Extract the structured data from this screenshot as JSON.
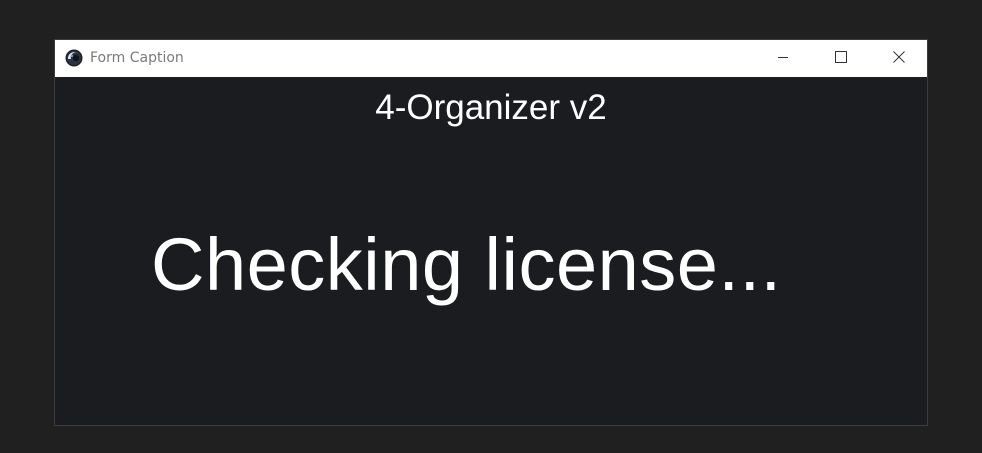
{
  "window": {
    "title": "Form Caption",
    "controls": {
      "minimize_icon": "minimize-icon",
      "maximize_icon": "maximize-icon",
      "close_icon": "close-icon"
    }
  },
  "content": {
    "app_name": "4-Organizer v2",
    "status": "Checking license..."
  },
  "colors": {
    "page_background": "#202020",
    "titlebar_background": "#ffffff",
    "client_background": "#1a1c20",
    "text": "#ffffff",
    "title_text": "#7a7a7a"
  }
}
